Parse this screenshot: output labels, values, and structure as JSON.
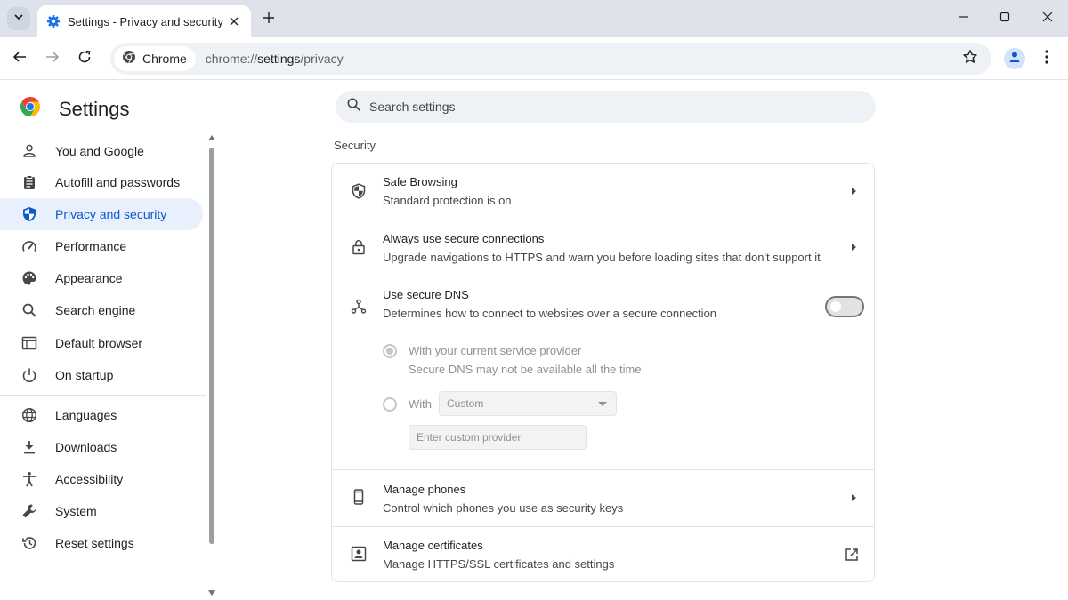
{
  "window": {
    "tab_title": "Settings - Privacy and security",
    "icons": [
      "tab-search-icon",
      "gear-icon",
      "close-icon",
      "plus-icon",
      "minimize-icon",
      "maximize-icon",
      "close-window-icon"
    ]
  },
  "toolbar": {
    "chip_label": "Chrome",
    "url_scheme": "chrome://",
    "url_host": "settings",
    "url_path": "/privacy",
    "icons": [
      "back-icon",
      "forward-icon",
      "reload-icon",
      "chrome-logo-icon",
      "star-icon",
      "profile-icon",
      "kebab-menu-icon"
    ]
  },
  "app": {
    "title": "Settings",
    "accent": "#0b57d0",
    "active_bg": "#e8f0fe"
  },
  "sidebar": {
    "items": [
      {
        "label": "You and Google",
        "icon": "person-icon"
      },
      {
        "label": "Autofill and passwords",
        "icon": "clipboard-icon"
      },
      {
        "label": "Privacy and security",
        "icon": "shield-icon",
        "active": true
      },
      {
        "label": "Performance",
        "icon": "speedometer-icon"
      },
      {
        "label": "Appearance",
        "icon": "palette-icon"
      },
      {
        "label": "Search engine",
        "icon": "search-icon"
      },
      {
        "label": "Default browser",
        "icon": "browser-window-icon"
      },
      {
        "label": "On startup",
        "icon": "power-icon"
      },
      {
        "label": "Languages",
        "icon": "globe-icon"
      },
      {
        "label": "Downloads",
        "icon": "download-icon"
      },
      {
        "label": "Accessibility",
        "icon": "accessibility-icon"
      },
      {
        "label": "System",
        "icon": "wrench-icon"
      },
      {
        "label": "Reset settings",
        "icon": "history-icon"
      }
    ]
  },
  "search": {
    "placeholder": "Search settings"
  },
  "section": {
    "title": "Security"
  },
  "rows": {
    "safe_browsing": {
      "title": "Safe Browsing",
      "subtitle": "Standard protection is on",
      "icon": "shield-outline-icon"
    },
    "secure_connections": {
      "title": "Always use secure connections",
      "subtitle": "Upgrade navigations to HTTPS and warn you before loading sites that don't support it",
      "icon": "lock-icon"
    },
    "secure_dns": {
      "title": "Use secure DNS",
      "subtitle": "Determines how to connect to websites over a secure connection",
      "icon": "dns-nodes-icon",
      "enabled": false,
      "option_current": {
        "label": "With your current service provider",
        "sublabel": "Secure DNS may not be available all the time",
        "selected": true
      },
      "option_custom": {
        "label": "With",
        "selected": false
      },
      "provider_select": {
        "value": "Custom"
      },
      "custom_provider": {
        "placeholder": "Enter custom provider",
        "value": ""
      }
    },
    "manage_phones": {
      "title": "Manage phones",
      "subtitle": "Control which phones you use as security keys",
      "icon": "phone-icon"
    },
    "manage_certificates": {
      "title": "Manage certificates",
      "subtitle": "Manage HTTPS/SSL certificates and settings",
      "icon": "certificate-icon"
    }
  }
}
